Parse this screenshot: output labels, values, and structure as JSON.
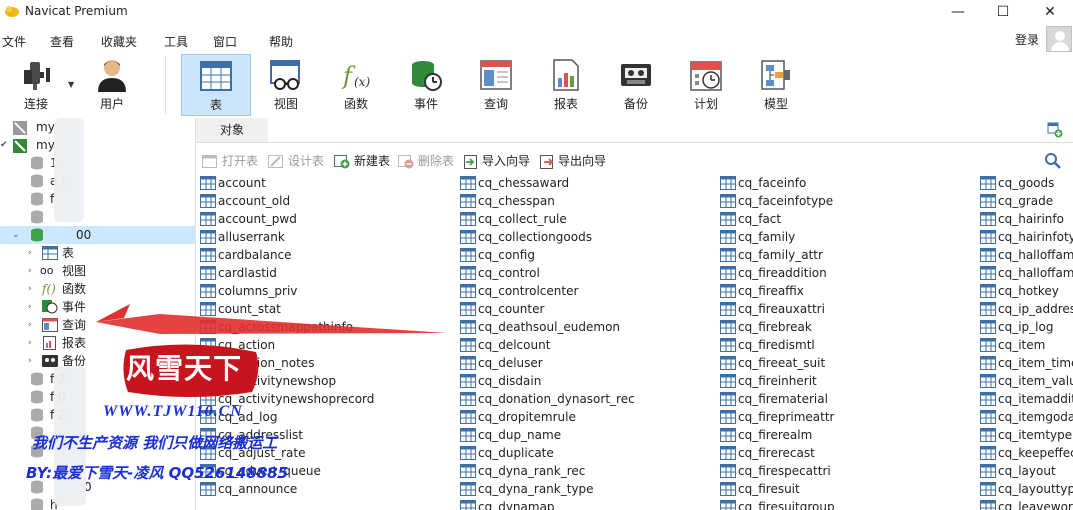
{
  "window": {
    "title": "Navicat Premium",
    "minimize": "—",
    "maximize": "☐",
    "close": "✕"
  },
  "menu": [
    "文件",
    "查看",
    "收藏夹",
    "工具",
    "窗口",
    "帮助"
  ],
  "login": "登录",
  "toolbar": {
    "connect": "连接",
    "user": "用户",
    "table": "表",
    "view": "视图",
    "function": "函数",
    "event": "事件",
    "query": "查询",
    "report": "报表",
    "backup": "备份",
    "schedule": "计划",
    "model": "模型"
  },
  "sidebar": {
    "items": [
      {
        "text": "my",
        "level": 0
      },
      {
        "text": "my",
        "level": 0
      },
      {
        "text": "1",
        "level": 1
      },
      {
        "text": "a      t",
        "level": 1
      },
      {
        "text": "f",
        "level": 1
      },
      {
        "text": "",
        "level": 1
      },
      {
        "text": "00",
        "level": 1
      },
      {
        "text": "表",
        "level": 2
      },
      {
        "text": "视图",
        "level": 2
      },
      {
        "text": "函数",
        "level": 2
      },
      {
        "text": "事件",
        "level": 2
      },
      {
        "text": "查询",
        "level": 2
      },
      {
        "text": "报表",
        "level": 2
      },
      {
        "text": "备份",
        "level": 2
      },
      {
        "text": "f        2",
        "level": 1
      },
      {
        "text": "f        0",
        "level": 1
      },
      {
        "text": "f        2",
        "level": 1
      },
      {
        "text": "",
        "level": 1
      },
      {
        "text": "",
        "level": 1
      },
      {
        "text": "0",
        "level": 1
      },
      {
        "text": "h",
        "level": 1
      }
    ]
  },
  "objects_tab": "对象",
  "subtoolbar": {
    "open": "打开表",
    "design": "设计表",
    "new": "新建表",
    "delete": "删除表",
    "import": "导入向导",
    "export": "导出向导"
  },
  "tables": {
    "col1": [
      "account",
      "account_old",
      "account_pwd",
      "alluserrank",
      "cardbalance",
      "cardlastid",
      "columns_priv",
      "count_stat",
      "cq_acrossmappathinfo",
      "cq_action",
      "cq_action_notes",
      "cq_activitynewshop",
      "cq_activitynewshoprecord",
      "cq_ad_log",
      "cq_addresslist",
      "cq_adjust_rate",
      "cq_advert_queue",
      "cq_announce"
    ],
    "col2": [
      "cq_chessaward",
      "cq_chesspan",
      "cq_collect_rule",
      "cq_collectiongoods",
      "cq_config",
      "cq_control",
      "cq_controlcenter",
      "cq_counter",
      "cq_deathsoul_eudemon",
      "cq_delcount",
      "cq_deluser",
      "cq_disdain",
      "cq_donation_dynasort_rec",
      "cq_dropitemrule",
      "cq_dup_name",
      "cq_duplicate",
      "cq_dyna_rank_rec",
      "cq_dyna_rank_type",
      "cq_dynamap"
    ],
    "col3": [
      "cq_faceinfo",
      "cq_faceinfotype",
      "cq_fact",
      "cq_family",
      "cq_family_attr",
      "cq_fireaddition",
      "cq_fireaffix",
      "cq_fireauxattri",
      "cq_firebreak",
      "cq_firedismtl",
      "cq_fireeat_suit",
      "cq_fireinherit",
      "cq_firematerial",
      "cq_fireprimeattr",
      "cq_firerealm",
      "cq_firerecast",
      "cq_firespecattri",
      "cq_firesuit",
      "cq_firesuitgroup"
    ],
    "col4": [
      "cq_goods",
      "cq_grade",
      "cq_hairinfo",
      "cq_hairinfotype",
      "cq_halloffame",
      "cq_halloffame",
      "cq_hotkey",
      "cq_ip_address",
      "cq_ip_log",
      "cq_item",
      "cq_item_timed",
      "cq_item_value",
      "cq_itemaddition",
      "cq_itemgodadd",
      "cq_itemtype",
      "cq_keepeffect",
      "cq_layout",
      "cq_layouttype",
      "cq_leaveword"
    ]
  },
  "watermark": {
    "logo": "风雪天下",
    "url": "WWW.TJW110.CN",
    "slogan": "我们不生产资源  我们只做网络搬运工",
    "author": "BY:最爱下雪天-凌风 QQ526148885"
  },
  "colors": {
    "accent": "#cce4f7",
    "selection": "#cce8ff",
    "watermark": "#1a2fd6",
    "arrow": "#e0302e",
    "logo": "#c8141c"
  }
}
